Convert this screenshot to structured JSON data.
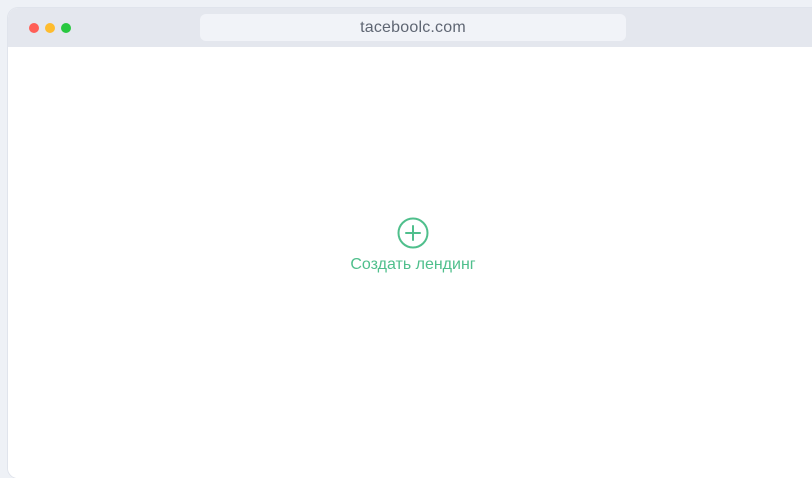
{
  "browser": {
    "url": "taceboolc.com",
    "traffic_lights": {
      "close": "#ff5f57",
      "minimize": "#febc2e",
      "maximize": "#28c840"
    }
  },
  "main": {
    "create_button": {
      "icon": "plus-circle-icon",
      "label": "Создать лендинг",
      "color": "#4fbf8c"
    }
  }
}
